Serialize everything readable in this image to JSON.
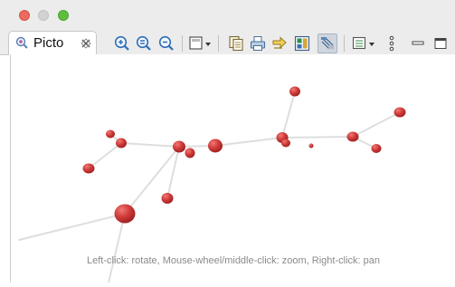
{
  "window": {
    "traffic_lights": [
      "close",
      "minimize",
      "zoom"
    ]
  },
  "tab": {
    "label": "Picto",
    "icon": "picto-view-icon",
    "close_icon": "close-tab-icon"
  },
  "toolbar": {
    "buttons": [
      {
        "name": "zoom-in-icon"
      },
      {
        "name": "zoom-fit-icon"
      },
      {
        "name": "zoom-out-icon"
      },
      {
        "name": "layout-dropdown-icon"
      },
      {
        "name": "copy-icon"
      },
      {
        "name": "print-icon"
      },
      {
        "name": "export-icon"
      },
      {
        "name": "save-image-icon"
      },
      {
        "name": "pick-mode-icon",
        "pressed": true
      },
      {
        "name": "view-menu-icon"
      },
      {
        "name": "more-options-icon"
      },
      {
        "name": "minimize-view-icon"
      },
      {
        "name": "maximize-view-icon"
      }
    ]
  },
  "canvas": {
    "hint": "Left-click: rotate, Mouse-wheel/middle-click: zoom, Right-click: pan",
    "node_color": "#d13a3a",
    "edge_color": "#dcdcdc"
  }
}
